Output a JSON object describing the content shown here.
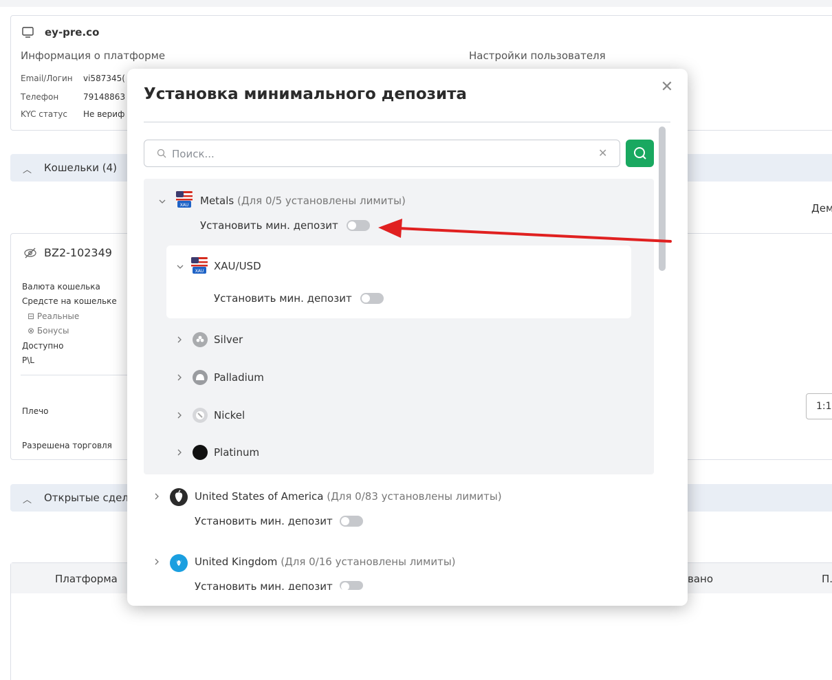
{
  "background": {
    "platform": {
      "domain": "ey-pre.co",
      "info_title": "Информация о платформе",
      "settings_title": "Настройки пользователя",
      "email_label": "Email/Логин",
      "email_value": "vi587345(",
      "phone_label": "Телефон",
      "phone_value": "79148863",
      "kyc_label": "KYC статус",
      "kyc_value": "Не вериф"
    },
    "wallets_section": "Кошельки (4)",
    "demo_fragment": "Дем",
    "wallet": {
      "id": "BZ2-102349",
      "currency_label": "Валюта кошелька",
      "funds_label": "Средсте на кошельке",
      "real_label": "Реальные",
      "bonus_label": "Бонусы",
      "available_label": "Доступно",
      "pl_label": "P\\L",
      "leverage_label": "Плечо",
      "leverage_value": "1:1",
      "trading_label": "Разрешена торговля"
    },
    "open_deals_section": "Открытые сдел",
    "table": {
      "col_platform": "Платформа",
      "col_fragment1": "вано",
      "col_fragment2": "П."
    }
  },
  "modal": {
    "title": "Установка минимального депозита",
    "search_placeholder": "Поиск...",
    "toggle_label": "Установить мин. депозит",
    "groups": [
      {
        "name": "Metals",
        "note": "(Для 0/5 установлены лимиты)",
        "expanded": true
      },
      {
        "name": "United States of America",
        "note": "(Для 0/83 установлены лимиты)",
        "expanded": false
      },
      {
        "name": "United Kingdom",
        "note": "(Для 0/16 установлены лимиты)",
        "expanded": false
      }
    ],
    "metals_children": [
      {
        "name": "XAU/USD",
        "expanded": true
      },
      {
        "name": "Silver"
      },
      {
        "name": "Palladium"
      },
      {
        "name": "Nickel"
      },
      {
        "name": "Platinum"
      }
    ],
    "flag_badge": "XAU"
  },
  "colors": {
    "accent_green": "#19a860",
    "arrow_red": "#e02020"
  },
  "icons": {
    "close": "close-icon",
    "search": "search-icon",
    "clear": "clear-icon",
    "chevron": "chevron-icon"
  }
}
